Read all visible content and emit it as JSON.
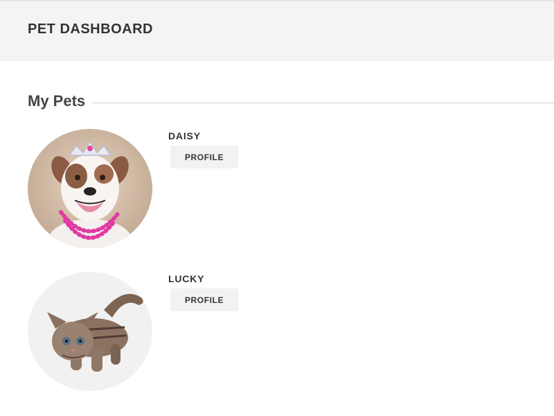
{
  "header": {
    "title": "PET DASHBOARD"
  },
  "section": {
    "title": "My Pets"
  },
  "pets": [
    {
      "name": "DAISY",
      "button_label": "PROFILE",
      "photo": "dog-photo"
    },
    {
      "name": "LUCKY",
      "button_label": "PROFILE",
      "photo": "cat-photo"
    }
  ]
}
